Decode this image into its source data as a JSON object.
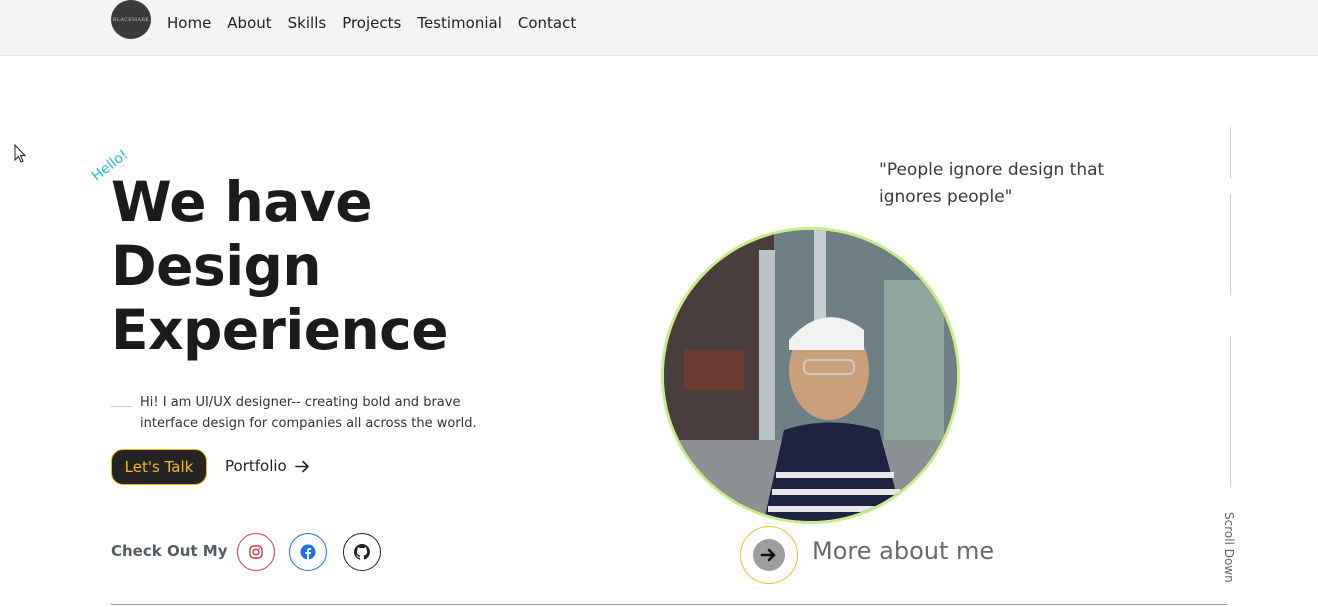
{
  "nav": {
    "logo_text": "BLACKMARK",
    "links": [
      "Home",
      "About",
      "Skills",
      "Projects",
      "Testimonial",
      "Contact"
    ]
  },
  "hero": {
    "greeting": "Hello!",
    "headline": [
      "We have",
      "Design",
      "Experience"
    ],
    "intro": "Hi! I am UI/UX designer-- creating bold and brave interface design for companies all across the world.",
    "cta_primary": "Let's Talk",
    "cta_secondary": "Portfolio",
    "social_label": "Check Out My",
    "social_icons": [
      "instagram-icon",
      "facebook-icon",
      "github-icon"
    ]
  },
  "quote": "\"People ignore design that ignores people\"",
  "more_about": "More about me",
  "scroll_label": "Scroll Down",
  "colors": {
    "accent_yellow": "#f4b81b",
    "accent_cyan": "#1fc2d9",
    "photo_ring": "#c8ec88",
    "dark": "#242424"
  }
}
